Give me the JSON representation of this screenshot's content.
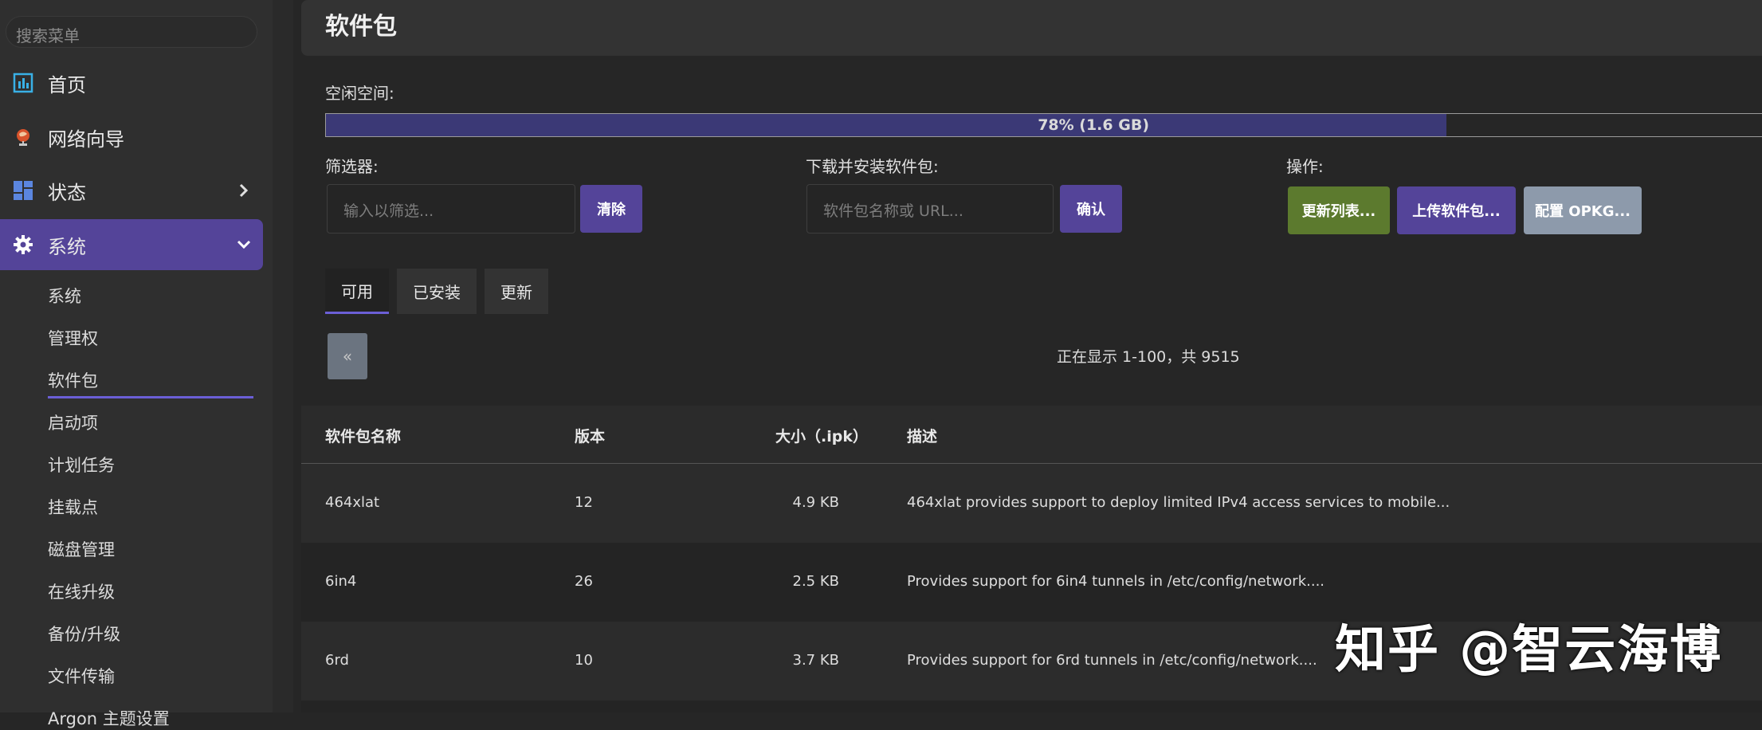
{
  "sidebar": {
    "search_placeholder": "搜索菜单",
    "menu": [
      {
        "label": "首页",
        "icon": "dashboard-icon"
      },
      {
        "label": "网络向导",
        "icon": "globe-icon"
      },
      {
        "label": "状态",
        "icon": "grid-icon"
      },
      {
        "label": "系统",
        "icon": "gear-icon"
      }
    ],
    "submenu": [
      "系统",
      "管理权",
      "软件包",
      "启动项",
      "计划任务",
      "挂载点",
      "磁盘管理",
      "在线升级",
      "备份/升级",
      "文件传输",
      "Argon 主题设置"
    ],
    "active_submenu": "软件包"
  },
  "main": {
    "title": "软件包",
    "free_space_label": "空闲空间:",
    "free_space": {
      "percent": 78,
      "text": "78% (1.6 GB)"
    },
    "filter_label": "筛选器:",
    "filter_placeholder": "输入以筛选...",
    "clear_label": "清除",
    "download_label": "下载并安装软件包:",
    "download_placeholder": "软件包名称或 URL...",
    "confirm_label": "确认",
    "actions_label": "操作:",
    "update_list_label": "更新列表...",
    "upload_label": "上传软件包...",
    "config_label": "配置 OPKG...",
    "tabs": [
      "可用",
      "已安装",
      "更新"
    ],
    "active_tab": "可用",
    "prev_label": "«",
    "paging_text": "正在显示 1-100，共 9515",
    "table": {
      "headers": [
        "软件包名称",
        "版本",
        "大小（.ipk）",
        "描述"
      ],
      "rows": [
        {
          "name": "464xlat",
          "version": "12",
          "size": "4.9 KB",
          "desc": "464xlat provides support to deploy limited IPv4 access services to mobile..."
        },
        {
          "name": "6in4",
          "version": "26",
          "size": "2.5 KB",
          "desc": "Provides support for 6in4 tunnels in /etc/config/network...."
        },
        {
          "name": "6rd",
          "version": "10",
          "size": "3.7 KB",
          "desc": "Provides support for 6rd tunnels in /etc/config/network...."
        }
      ]
    }
  },
  "watermark": "知乎 @智云海博",
  "colors": {
    "accent": "#544499",
    "green": "#5c7a2e",
    "gray_button": "#8d9aab",
    "progress_fill": "#3b3976"
  }
}
